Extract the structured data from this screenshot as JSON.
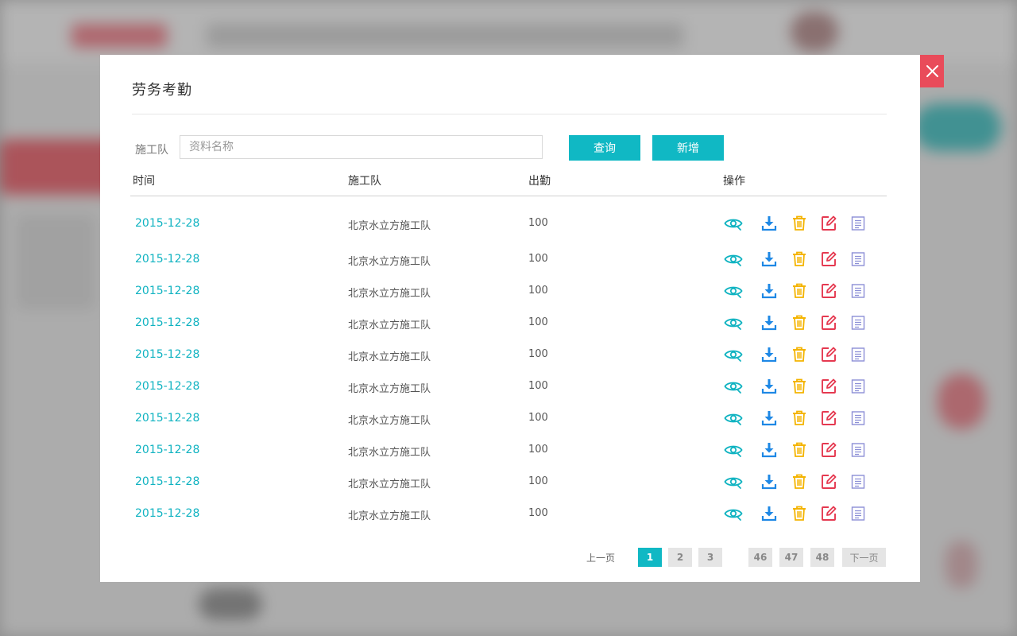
{
  "modal": {
    "title": "劳务考勤",
    "close_icon": "close-icon"
  },
  "filter": {
    "label": "施工队",
    "placeholder": "资料名称",
    "value": "",
    "query_label": "查询",
    "add_label": "新增"
  },
  "table": {
    "headers": [
      "时间",
      "施工队",
      "出勤",
      "操作"
    ],
    "rows": [
      {
        "date": "2015-12-28",
        "team": "北京水立方施工队",
        "attendance": "100"
      },
      {
        "date": "2015-12-28",
        "team": "北京水立方施工队",
        "attendance": "100"
      },
      {
        "date": "2015-12-28",
        "team": "北京水立方施工队",
        "attendance": "100"
      },
      {
        "date": "2015-12-28",
        "team": "北京水立方施工队",
        "attendance": "100"
      },
      {
        "date": "2015-12-28",
        "team": "北京水立方施工队",
        "attendance": "100"
      },
      {
        "date": "2015-12-28",
        "team": "北京水立方施工队",
        "attendance": "100"
      },
      {
        "date": "2015-12-28",
        "team": "北京水立方施工队",
        "attendance": "100"
      },
      {
        "date": "2015-12-28",
        "team": "北京水立方施工队",
        "attendance": "100"
      },
      {
        "date": "2015-12-28",
        "team": "北京水立方施工队",
        "attendance": "100"
      },
      {
        "date": "2015-12-28",
        "team": "北京水立方施工队",
        "attendance": "100"
      }
    ],
    "actions": [
      {
        "icon": "eye-icon",
        "color": "#10b3c1"
      },
      {
        "icon": "download-icon",
        "color": "#1e88e5"
      },
      {
        "icon": "trash-icon",
        "color": "#f4b400"
      },
      {
        "icon": "edit-icon",
        "color": "#e53950"
      },
      {
        "icon": "list-icon",
        "color": "#8c8fd6"
      }
    ]
  },
  "pagination": {
    "prev_label": "上一页",
    "next_label": "下一页",
    "pages": [
      "1",
      "2",
      "3",
      "46",
      "47",
      "48"
    ],
    "current": "1"
  },
  "colors": {
    "accent": "#10b8c4",
    "close": "#e94b5a"
  }
}
